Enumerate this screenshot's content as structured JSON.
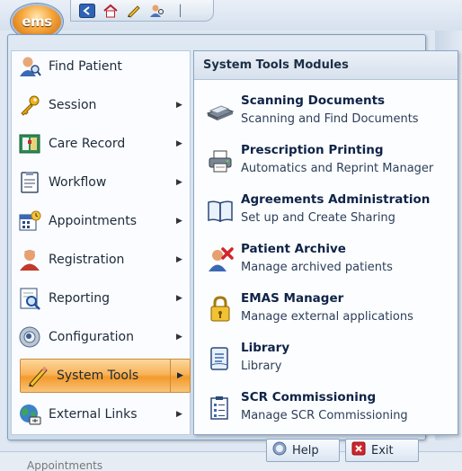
{
  "app": {
    "logo_text": "ems"
  },
  "quick_access": {
    "buttons": [
      "back-arrow-icon",
      "home-icon",
      "pencil-icon",
      "patient-search-icon"
    ],
    "customize_label": "│"
  },
  "main_menu": {
    "items": [
      {
        "label": "Find Patient",
        "icon": "find-patient-icon",
        "has_submenu": false
      },
      {
        "label": "Session",
        "icon": "key-icon",
        "has_submenu": true
      },
      {
        "label": "Care Record",
        "icon": "care-record-icon",
        "has_submenu": true
      },
      {
        "label": "Workflow",
        "icon": "workflow-icon",
        "has_submenu": true
      },
      {
        "label": "Appointments",
        "icon": "calendar-icon",
        "has_submenu": true
      },
      {
        "label": "Registration",
        "icon": "registration-icon",
        "has_submenu": true
      },
      {
        "label": "Reporting",
        "icon": "reporting-icon",
        "has_submenu": true
      },
      {
        "label": "Configuration",
        "icon": "configuration-icon",
        "has_submenu": true
      },
      {
        "label": "System Tools",
        "icon": "pencil-icon",
        "has_submenu": true,
        "active": true
      },
      {
        "label": "External Links",
        "icon": "globe-icon",
        "has_submenu": true
      }
    ]
  },
  "submenu": {
    "title": "System Tools Modules",
    "items": [
      {
        "title": "Scanning  Documents",
        "description": "Scanning and Find Documents",
        "icon": "scanner-icon"
      },
      {
        "title": "Prescription Printing",
        "description": "Automatics and Reprint Manager",
        "icon": "printer-icon"
      },
      {
        "title": "Agreements Administration",
        "description": "Set up and Create Sharing",
        "icon": "book-icon"
      },
      {
        "title": "Patient Archive",
        "description": "Manage archived patients",
        "icon": "archive-patient-icon"
      },
      {
        "title": "EMAS Manager",
        "description": "Manage external applications",
        "icon": "padlock-icon"
      },
      {
        "title": "Library",
        "description": "Library",
        "icon": "library-icon"
      },
      {
        "title": "SCR Commissioning",
        "description": "Manage SCR Commissioning",
        "icon": "scr-icon"
      }
    ]
  },
  "footer": {
    "help_label": "Help",
    "exit_label": "Exit"
  },
  "background": {
    "status_text": "Appointments"
  },
  "colors": {
    "accent_orange": "#f8b35a",
    "frame_blue": "#7f9cbf",
    "exit_red": "#d0262c"
  }
}
